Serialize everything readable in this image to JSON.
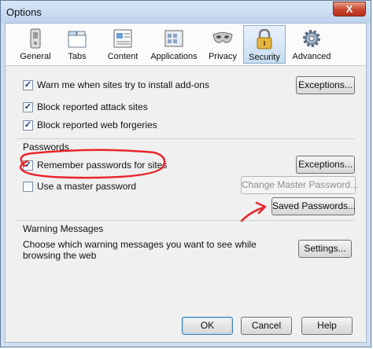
{
  "window": {
    "title": "Options",
    "close_glyph": "X"
  },
  "toolbar": {
    "items": [
      {
        "label": "General",
        "icon": "general-icon"
      },
      {
        "label": "Tabs",
        "icon": "tabs-icon"
      },
      {
        "label": "Content",
        "icon": "content-icon"
      },
      {
        "label": "Applications",
        "icon": "applications-icon"
      },
      {
        "label": "Privacy",
        "icon": "privacy-mask-icon"
      },
      {
        "label": "Security",
        "icon": "security-padlock-icon",
        "selected": true
      },
      {
        "label": "Advanced",
        "icon": "advanced-gear-icon"
      }
    ]
  },
  "security": {
    "warn_addons": {
      "label": "Warn me when sites try to install add-ons",
      "checked": true
    },
    "exceptions1_label": "Exceptions...",
    "block_attack": {
      "label": "Block reported attack sites",
      "checked": true
    },
    "block_forgeries": {
      "label": "Block reported web forgeries",
      "checked": true
    }
  },
  "passwords": {
    "group_label": "Passwords",
    "remember": {
      "label": "Remember passwords for sites",
      "checked": true
    },
    "exceptions2_label": "Exceptions...",
    "master": {
      "label": "Use a master password",
      "checked": false
    },
    "change_master_label": "Change Master Password...",
    "saved_passwords_label": "Saved Passwords..."
  },
  "warnings": {
    "group_label": "Warning Messages",
    "description": "Choose which warning messages you want to see while browsing the web",
    "settings_label": "Settings..."
  },
  "footer": {
    "ok_label": "OK",
    "cancel_label": "Cancel",
    "help_label": "Help"
  },
  "annotation_color": "#e8262b"
}
